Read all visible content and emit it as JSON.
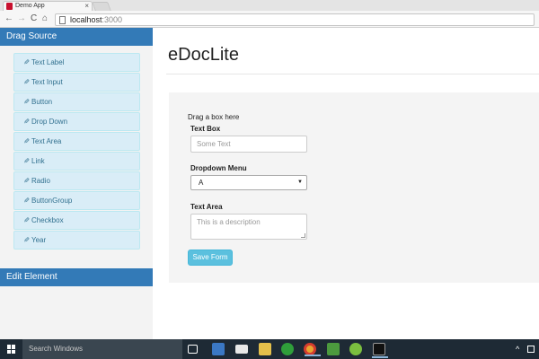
{
  "browser": {
    "tab_title": "Demo App",
    "tab_close": "×",
    "url_host": "localhost",
    "url_port": ":3000",
    "back": "←",
    "forward": "→",
    "reload": "C",
    "home": "⌂"
  },
  "sidebar": {
    "drag_source_header": "Drag Source",
    "items": [
      {
        "label": "Text Label"
      },
      {
        "label": "Text Input"
      },
      {
        "label": "Button"
      },
      {
        "label": "Drop Down"
      },
      {
        "label": "Text Area"
      },
      {
        "label": "Link"
      },
      {
        "label": "Radio"
      },
      {
        "label": "ButtonGroup"
      },
      {
        "label": "Checkbox"
      },
      {
        "label": "Year"
      }
    ],
    "item_icon": "pencil-icon",
    "edit_element_header": "Edit Element"
  },
  "main": {
    "title": "eDocLite",
    "drag_hint": "Drag a box here",
    "text_box": {
      "label": "Text Box",
      "placeholder": "Some Text"
    },
    "dropdown": {
      "label": "Dropdown Menu",
      "selected": "A",
      "caret": "▼"
    },
    "text_area": {
      "label": "Text Area",
      "placeholder": "This is a description"
    },
    "save_button": "Save Form"
  },
  "taskbar": {
    "search_placeholder": "Search Windows",
    "tray_arrow": "^",
    "icons": [
      "task-view-icon",
      "store-icon",
      "mail-icon",
      "file-explorer-icon",
      "xbox-icon",
      "chrome-icon",
      "download-icon",
      "android-studio-icon",
      "terminal-icon"
    ],
    "colors": {
      "taskbar_bg": "#1e2a35",
      "accent": "#337ab7",
      "button": "#5bc0de",
      "list_bg": "#d9edf7"
    }
  }
}
